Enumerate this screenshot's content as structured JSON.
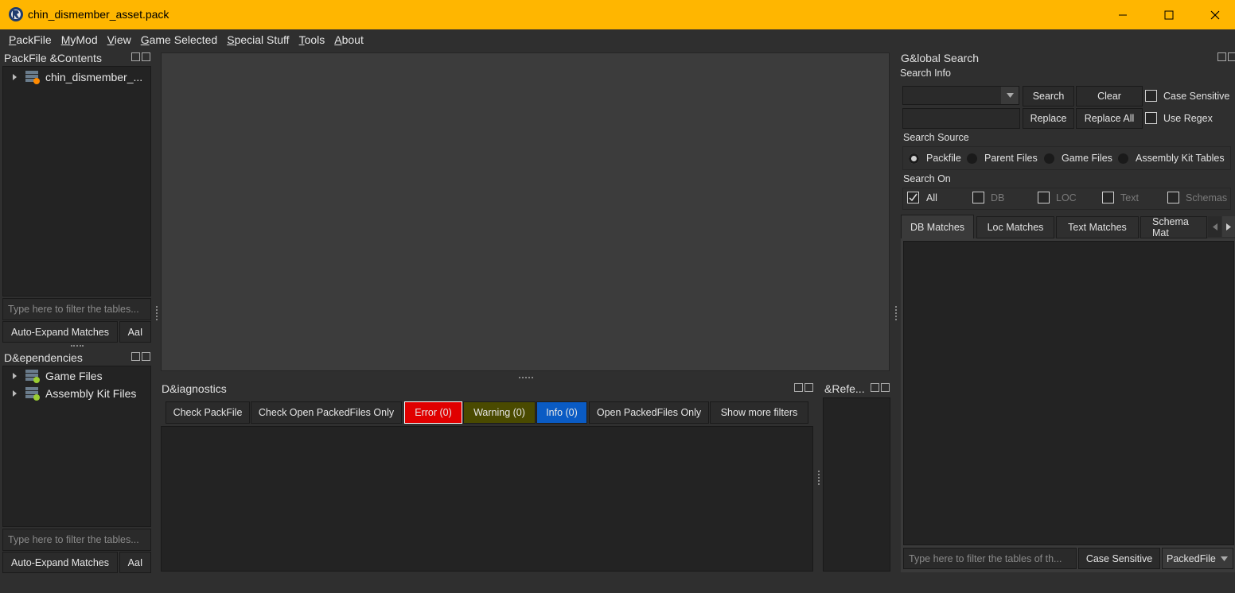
{
  "window": {
    "title": "chin_dismember_asset.pack",
    "minimize_icon": "minimize-icon",
    "maximize_icon": "maximize-icon",
    "close_icon": "close-icon"
  },
  "menu": [
    {
      "pre": "",
      "u": "P",
      "post": "ackFile"
    },
    {
      "pre": "",
      "u": "M",
      "post": "yMod"
    },
    {
      "pre": "",
      "u": "V",
      "post": "iew"
    },
    {
      "pre": "",
      "u": "G",
      "post": "ame Selected"
    },
    {
      "pre": "",
      "u": "S",
      "post": "pecial Stuff"
    },
    {
      "pre": "",
      "u": "T",
      "post": "ools"
    },
    {
      "pre": "",
      "u": "A",
      "post": "bout"
    }
  ],
  "packfile_contents": {
    "title": "PackFile &Contents",
    "tree": [
      {
        "label": "chin_dismember_...",
        "icon": "packfile-icon"
      }
    ],
    "filter_placeholder": "Type here to filter the tables...",
    "auto_expand": "Auto-Expand Matches",
    "case_btn": "AaI"
  },
  "dependencies": {
    "title": "D&ependencies",
    "tree": [
      {
        "label": "Game Files",
        "icon": "game-files-icon"
      },
      {
        "label": "Assembly Kit Files",
        "icon": "assembly-kit-icon"
      }
    ],
    "filter_placeholder": "Type here to filter the tables...",
    "auto_expand": "Auto-Expand Matches",
    "case_btn": "AaI"
  },
  "diagnostics": {
    "title": "D&iagnostics",
    "buttons": {
      "check_packfile": "Check PackFile",
      "check_open": "Check Open PackedFiles Only",
      "error": "Error (0)",
      "warning": "Warning (0)",
      "info": "Info (0)",
      "open_only": "Open PackedFiles Only",
      "more_filters": "Show more filters"
    },
    "colors": {
      "error": "#e00000",
      "warning": "#4a4a00",
      "info": "#0a5bc4"
    }
  },
  "references": {
    "title": "&Refe..."
  },
  "global_search": {
    "title": "G&lobal Search",
    "search_info": "Search Info",
    "search_btn": "Search",
    "clear_btn": "Clear",
    "replace_btn": "Replace",
    "replace_all_btn": "Replace All",
    "case_sensitive": "Case Sensitive",
    "use_regex": "Use Regex",
    "search_source": "Search Source",
    "sources": [
      {
        "label": "Packfile",
        "selected": true
      },
      {
        "label": "Parent Files",
        "selected": false
      },
      {
        "label": "Game Files",
        "selected": false
      },
      {
        "label": "Assembly Kit Tables",
        "selected": false
      }
    ],
    "search_on": "Search On",
    "search_on_items": [
      {
        "label": "All",
        "checked": true,
        "enabled": true
      },
      {
        "label": "DB",
        "checked": false,
        "enabled": false
      },
      {
        "label": "LOC",
        "checked": false,
        "enabled": false
      },
      {
        "label": "Text",
        "checked": false,
        "enabled": false
      },
      {
        "label": "Schemas",
        "checked": false,
        "enabled": false
      }
    ],
    "tabs": [
      "DB Matches",
      "Loc Matches",
      "Text Matches",
      "Schema Mat"
    ],
    "filter_placeholder": "Type here to filter the tables of th...",
    "case_sensitive_btn": "Case Sensitive",
    "combo_value": "PackedFile"
  }
}
